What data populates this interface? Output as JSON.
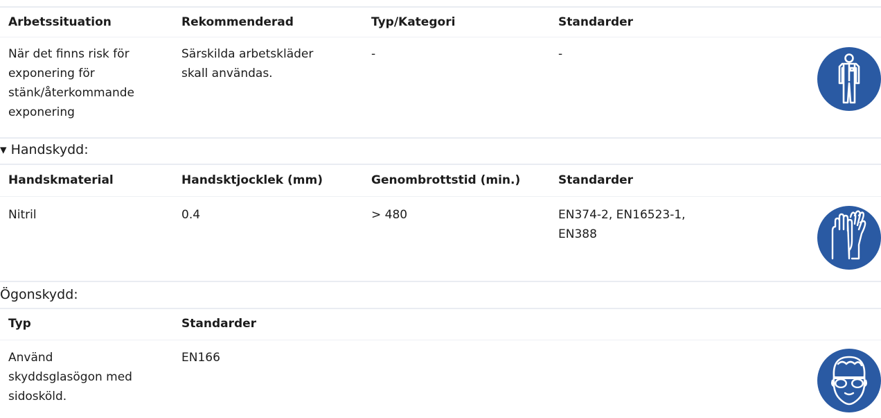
{
  "section1": {
    "headers": [
      "Arbetssituation",
      "Rekommenderad",
      "Typ/Kategori",
      "Standarder"
    ],
    "row": {
      "situation_lines": [
        "När det finns risk för",
        "exponering för",
        "stänk/återkommande",
        "exponering"
      ],
      "recommended_lines": [
        "Särskilda arbetskläder",
        "skall användas."
      ],
      "type": "-",
      "standards": "-"
    },
    "icon": "protective-clothing-icon"
  },
  "section2": {
    "title": "▾ Handskydd:",
    "headers": [
      "Handskmaterial",
      "Handsktjocklek (mm)",
      "Genombrottstid (min.)",
      "Standarder"
    ],
    "row": {
      "material": "Nitril",
      "thickness": "0.4",
      "breakthrough": "> 480",
      "standards_lines": [
        "EN374-2, EN16523-1,",
        "EN388"
      ]
    },
    "icon": "gloves-icon"
  },
  "section3": {
    "title": "Ögonskydd:",
    "headers": [
      "Typ",
      "Standarder"
    ],
    "row": {
      "type_lines": [
        "Använd",
        "skyddsglasögon med",
        "sidosköld."
      ],
      "standards": "EN166"
    },
    "icon": "safety-goggles-icon"
  },
  "colors": {
    "icon_blue": "#2a5aa3",
    "divider": "#e9ecf2"
  }
}
